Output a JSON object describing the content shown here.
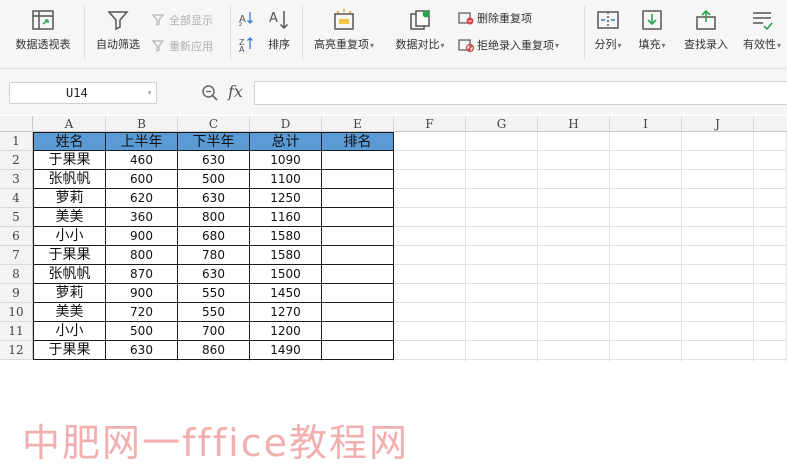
{
  "ribbon": {
    "pivot_label": "数据透视表",
    "autofilter_label": "自动筛选",
    "show_all_label": "全部显示",
    "reapply_label": "重新应用",
    "sort_label": "排序",
    "highlight_dup_label": "高亮重复项",
    "compare_label": "数据对比",
    "delete_dup_label": "删除重复项",
    "reject_dup_label": "拒绝录入重复项",
    "split_label": "分列",
    "fill_label": "填充",
    "find_entry_label": "查找录入",
    "validity_label": "有效性"
  },
  "formula_bar": {
    "cell_ref": "U14",
    "fx_label": "fx",
    "formula": ""
  },
  "grid": {
    "columns": [
      "A",
      "B",
      "C",
      "D",
      "E",
      "F",
      "G",
      "H",
      "I",
      "J"
    ],
    "rows": [
      "1",
      "2",
      "3",
      "4",
      "5",
      "6",
      "7",
      "8",
      "9",
      "10",
      "11",
      "12"
    ],
    "header_color": "#5b9bd5",
    "table_header": [
      "姓名",
      "上半年",
      "下半年",
      "总计",
      "排名"
    ],
    "table_rows": [
      [
        "于果果",
        "460",
        "630",
        "1090",
        ""
      ],
      [
        "张帆帆",
        "600",
        "500",
        "1100",
        ""
      ],
      [
        "萝莉",
        "620",
        "630",
        "1250",
        ""
      ],
      [
        "美美",
        "360",
        "800",
        "1160",
        ""
      ],
      [
        "小小",
        "900",
        "680",
        "1580",
        ""
      ],
      [
        "于果果",
        "800",
        "780",
        "1580",
        ""
      ],
      [
        "张帆帆",
        "870",
        "630",
        "1500",
        ""
      ],
      [
        "萝莉",
        "900",
        "550",
        "1450",
        ""
      ],
      [
        "美美",
        "720",
        "550",
        "1270",
        ""
      ],
      [
        "小小",
        "500",
        "700",
        "1200",
        ""
      ],
      [
        "于果果",
        "630",
        "860",
        "1490",
        ""
      ]
    ]
  },
  "watermark": "中肥网一fffice教程网"
}
